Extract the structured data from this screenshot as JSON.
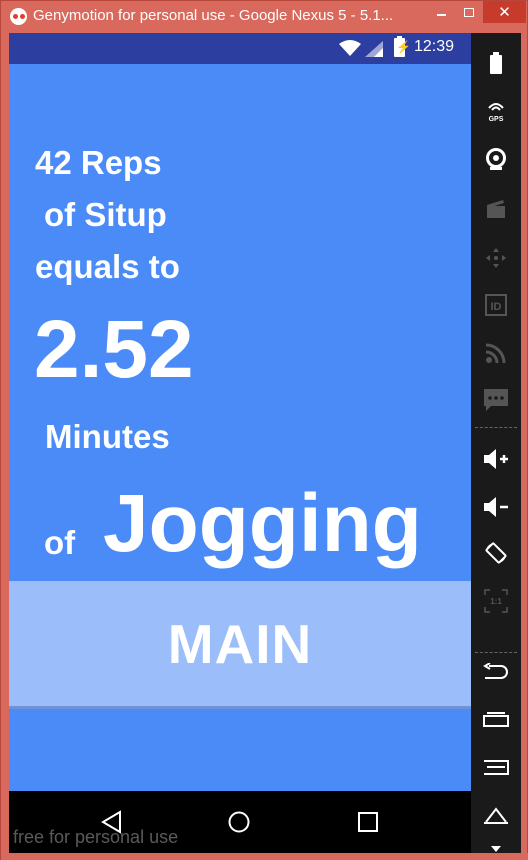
{
  "window": {
    "title": "Genymotion for personal use - Google Nexus 5 - 5.1...",
    "close_glyph": "✕"
  },
  "status_bar": {
    "time": "12:39",
    "icons": [
      "wifi-icon",
      "signal-icon",
      "battery-charging-icon"
    ]
  },
  "content": {
    "reps_line": "42 Reps",
    "exercise_line": "of Situp",
    "equals_line": "equals to",
    "result_value": "2.52",
    "minutes_line": "Minutes",
    "of_label": "of",
    "activity": "Jogging"
  },
  "main_button": {
    "label": "MAIN"
  },
  "nav_bar": {
    "buttons": [
      "back-icon",
      "home-icon",
      "recents-icon"
    ]
  },
  "watermark": "free for personal use",
  "sidebar": {
    "items": [
      {
        "name": "battery-icon"
      },
      {
        "name": "gps-icon",
        "label": "GPS"
      },
      {
        "name": "webcam-icon"
      },
      {
        "name": "screencast-icon"
      },
      {
        "name": "dpad-icon"
      },
      {
        "name": "device-id-icon",
        "label": "ID"
      },
      {
        "name": "rss-icon"
      },
      {
        "name": "sms-icon"
      },
      {
        "name": "volume-up-icon"
      },
      {
        "name": "volume-down-icon"
      },
      {
        "name": "rotate-icon"
      },
      {
        "name": "pixel-perfect-icon",
        "label": "1:1"
      },
      {
        "name": "back-icon"
      },
      {
        "name": "recents-icon"
      },
      {
        "name": "menu-icon"
      },
      {
        "name": "home-icon"
      },
      {
        "name": "power-icon"
      }
    ]
  },
  "colors": {
    "frame": "#d9695c",
    "status_bar": "#2c3fa0",
    "screen_background": "#4b8bf7",
    "button_background": "#9bbdf9",
    "sidebar": "#1a1a1a"
  }
}
